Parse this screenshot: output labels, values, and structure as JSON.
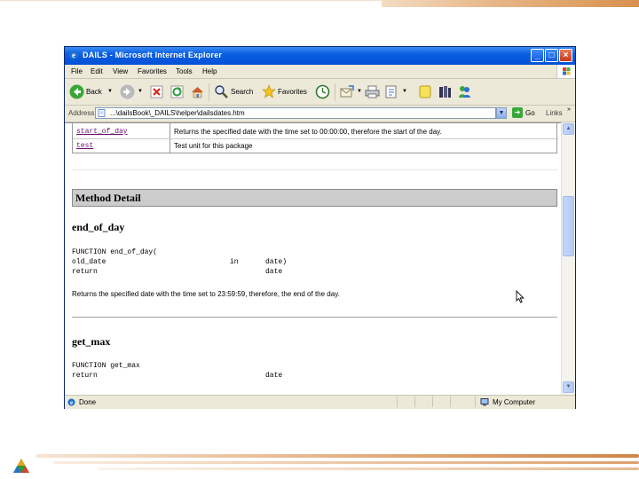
{
  "window": {
    "title": "DAILS - Microsoft Internet Explorer",
    "controls": {
      "minimize": "_",
      "maximize": "□",
      "close": "×"
    }
  },
  "menu": [
    "File",
    "Edit",
    "View",
    "Favorites",
    "Tools",
    "Help"
  ],
  "toolbar": {
    "back_label": "Back",
    "search_label": "Search",
    "favorites_label": "Favorites"
  },
  "address": {
    "label": "Address",
    "value": "...\\dailsBook\\_DAILS\\helper\\dailsdates.htm",
    "go_label": "Go",
    "links_label": "Links",
    "more": "»"
  },
  "summary_rows": [
    {
      "name": "start_of_day",
      "desc": "Returns the specified date with the time set to 00:00:00, therefore the start of the day."
    },
    {
      "name": "test",
      "desc": "Test unit for this package"
    }
  ],
  "method_detail": {
    "heading": "Method Detail",
    "methods": [
      {
        "name": "end_of_day",
        "signature": "FUNCTION end_of_day(",
        "params": [
          {
            "name": "old_date",
            "mode": "in",
            "type": "date)"
          },
          {
            "name": "return",
            "mode": "",
            "type": "date"
          }
        ],
        "description": "Returns the specified date with the time set to 23:59:59, therefore, the end of the day."
      },
      {
        "name": "get_max",
        "signature": "FUNCTION get_max",
        "params": [
          {
            "name": "return",
            "mode": "",
            "type": "date"
          }
        ]
      }
    ]
  },
  "status": {
    "text": "Done",
    "zone": "My Computer"
  },
  "scroll": {
    "up": "▲",
    "down": "▼"
  }
}
